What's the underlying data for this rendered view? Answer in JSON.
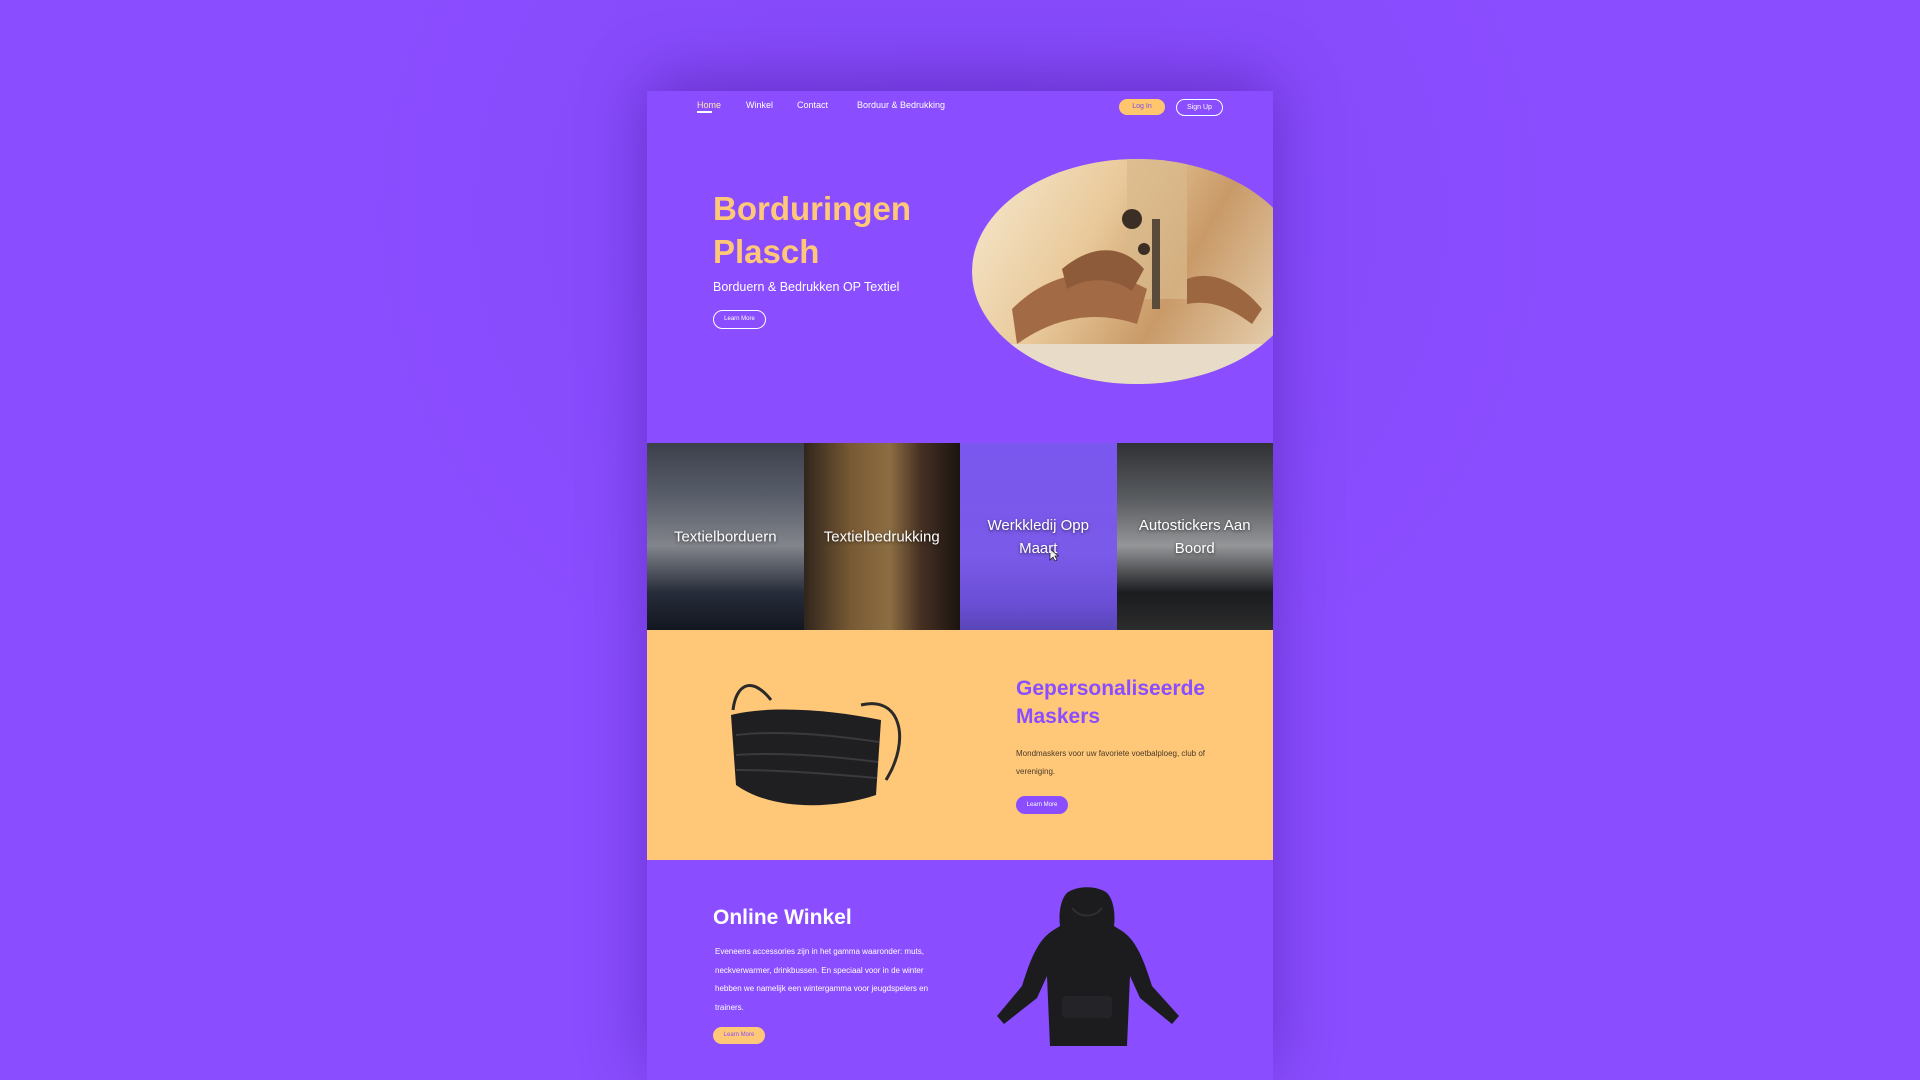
{
  "nav": {
    "links": [
      "Home",
      "Winkel",
      "Contact",
      "Borduur & Bedrukking"
    ],
    "login": "Log In",
    "signup": "Sign Up"
  },
  "hero": {
    "title": "Borduringen Plasch",
    "subtitle": "Borduern & Bedrukken OP Textiel",
    "button": "Learn More"
  },
  "tiles": [
    {
      "label": "Textielborduern"
    },
    {
      "label": "Textielbedrukking"
    },
    {
      "label": "Werkkledij Opp Maart"
    },
    {
      "label": "Autostickers Aan Boord"
    }
  ],
  "masks": {
    "title": "Gepersonaliseerde Maskers",
    "text": "Mondmaskers voor uw favoriete voetbalploeg, club of vereniging.",
    "button": "Learn More"
  },
  "shop": {
    "title": "Online Winkel",
    "text": "Eveneens accessories zijn in het gamma waaronder: muts, neckverwarmer, drinkbussen. En speciaal voor in de winter hebben we namelijk een wintergamma voor jeugdspelers en trainers.",
    "button": "Learn More"
  },
  "colors": {
    "background": "#8a4dff",
    "accent_yellow": "#ffc878",
    "text_light": "#ffffff"
  }
}
